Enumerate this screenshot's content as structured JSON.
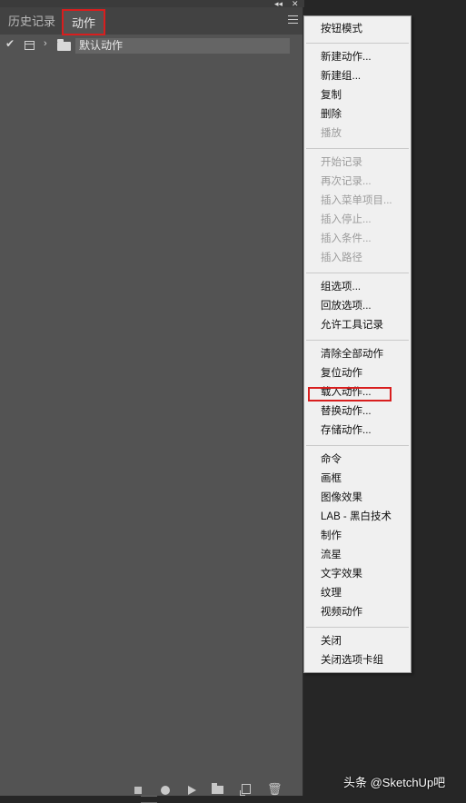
{
  "panel": {
    "tabs": [
      {
        "label": "历史记录",
        "active": false
      },
      {
        "label": "动作",
        "active": true
      }
    ],
    "action_set": {
      "name": "默认动作",
      "checked": true,
      "check_glyph": "✔",
      "expand_glyph": "›"
    },
    "bottom_icons": [
      "stop-icon",
      "record-icon",
      "play-icon",
      "new-set-icon",
      "new-action-icon",
      "trash-icon"
    ],
    "top_controls": {
      "collapse": "◂◂",
      "close": "✕"
    }
  },
  "menu": {
    "items": [
      {
        "label": "按钮模式",
        "enabled": true
      },
      {
        "label": "新建动作...",
        "enabled": true
      },
      {
        "label": "新建组...",
        "enabled": true
      },
      {
        "label": "复制",
        "enabled": true
      },
      {
        "label": "删除",
        "enabled": true
      },
      {
        "label": "播放",
        "enabled": false
      },
      {
        "label": "开始记录",
        "enabled": false
      },
      {
        "label": "再次记录...",
        "enabled": false
      },
      {
        "label": "插入菜单项目...",
        "enabled": false
      },
      {
        "label": "插入停止...",
        "enabled": false
      },
      {
        "label": "插入条件...",
        "enabled": false
      },
      {
        "label": "插入路径",
        "enabled": false
      },
      {
        "label": "组选项...",
        "enabled": true
      },
      {
        "label": "回放选项...",
        "enabled": true
      },
      {
        "label": "允许工具记录",
        "enabled": true
      },
      {
        "label": "清除全部动作",
        "enabled": true
      },
      {
        "label": "复位动作",
        "enabled": true
      },
      {
        "label": "载入动作...",
        "enabled": true,
        "highlighted": true
      },
      {
        "label": "替换动作...",
        "enabled": true
      },
      {
        "label": "存储动作...",
        "enabled": true
      },
      {
        "label": "命令",
        "enabled": true
      },
      {
        "label": "画框",
        "enabled": true
      },
      {
        "label": "图像效果",
        "enabled": true
      },
      {
        "label": "LAB - 黑白技术",
        "enabled": true
      },
      {
        "label": "制作",
        "enabled": true
      },
      {
        "label": "流星",
        "enabled": true
      },
      {
        "label": "文字效果",
        "enabled": true
      },
      {
        "label": "纹理",
        "enabled": true
      },
      {
        "label": "视频动作",
        "enabled": true
      },
      {
        "label": "关闭",
        "enabled": true
      },
      {
        "label": "关闭选项卡组",
        "enabled": true
      }
    ]
  },
  "watermark": "头条 @SketchUp吧",
  "colors": {
    "highlight_red": "#d81e1e",
    "panel_bg": "#535353",
    "menu_bg": "#f0f0f0",
    "disabled_text": "#9c9c9c"
  }
}
